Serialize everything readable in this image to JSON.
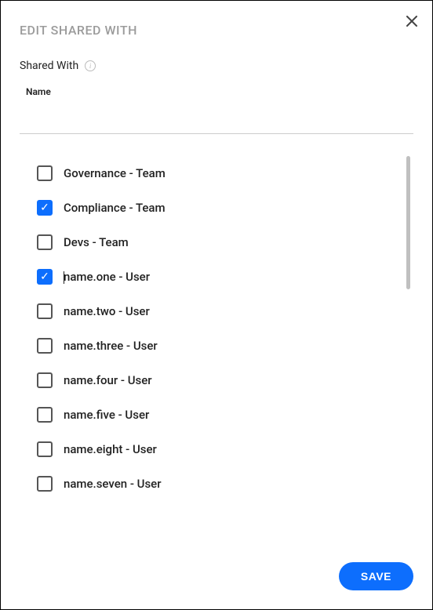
{
  "dialog": {
    "title": "EDIT SHARED WITH",
    "shared_with_label": "Shared With",
    "name_header": "Name",
    "search_placeholder": "",
    "save_label": "SAVE"
  },
  "items": [
    {
      "label": "Governance - Team",
      "checked": false,
      "cursor": false
    },
    {
      "label": "Compliance - Team",
      "checked": true,
      "cursor": false
    },
    {
      "label": "Devs - Team",
      "checked": false,
      "cursor": false
    },
    {
      "label": "name.one - User",
      "checked": true,
      "cursor": true
    },
    {
      "label": "name.two - User",
      "checked": false,
      "cursor": false
    },
    {
      "label": "name.three - User",
      "checked": false,
      "cursor": false
    },
    {
      "label": "name.four - User",
      "checked": false,
      "cursor": false
    },
    {
      "label": "name.five - User",
      "checked": false,
      "cursor": false
    },
    {
      "label": "name.eight - User",
      "checked": false,
      "cursor": false
    },
    {
      "label": "name.seven - User",
      "checked": false,
      "cursor": false
    }
  ],
  "colors": {
    "accent": "#0d6efd"
  }
}
